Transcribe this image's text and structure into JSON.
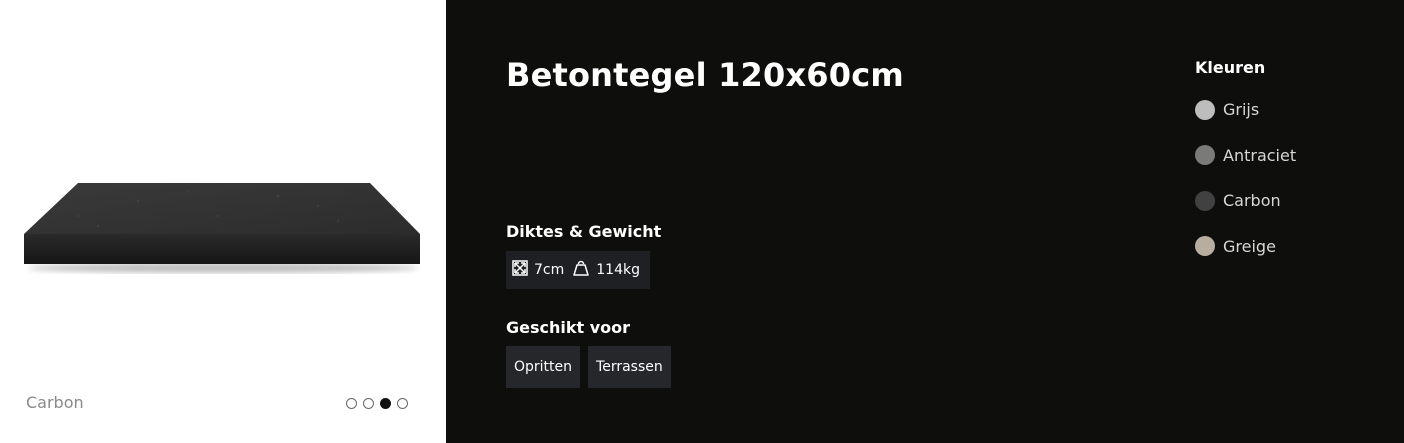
{
  "gallery": {
    "caption": "Carbon",
    "dots": [
      {
        "active": false
      },
      {
        "active": false
      },
      {
        "active": true
      },
      {
        "active": false
      }
    ]
  },
  "product": {
    "title": "Betontegel 120x60cm",
    "specs": {
      "label": "Diktes & Gewicht",
      "thickness": "7cm",
      "weight": "114kg"
    },
    "suitable": {
      "label": "Geschikt voor",
      "tags": [
        "Opritten",
        "Terrassen"
      ]
    },
    "colors": {
      "label": "Kleuren",
      "items": [
        {
          "name": "Grijs",
          "hex": "#bdbdbd"
        },
        {
          "name": "Antraciet",
          "hex": "#7a7a79"
        },
        {
          "name": "Carbon",
          "hex": "#414141"
        },
        {
          "name": "Greige",
          "hex": "#b8ae9f"
        }
      ]
    }
  },
  "icons": {
    "thickness": "dimension-arrows-icon",
    "weight": "weight-icon"
  }
}
